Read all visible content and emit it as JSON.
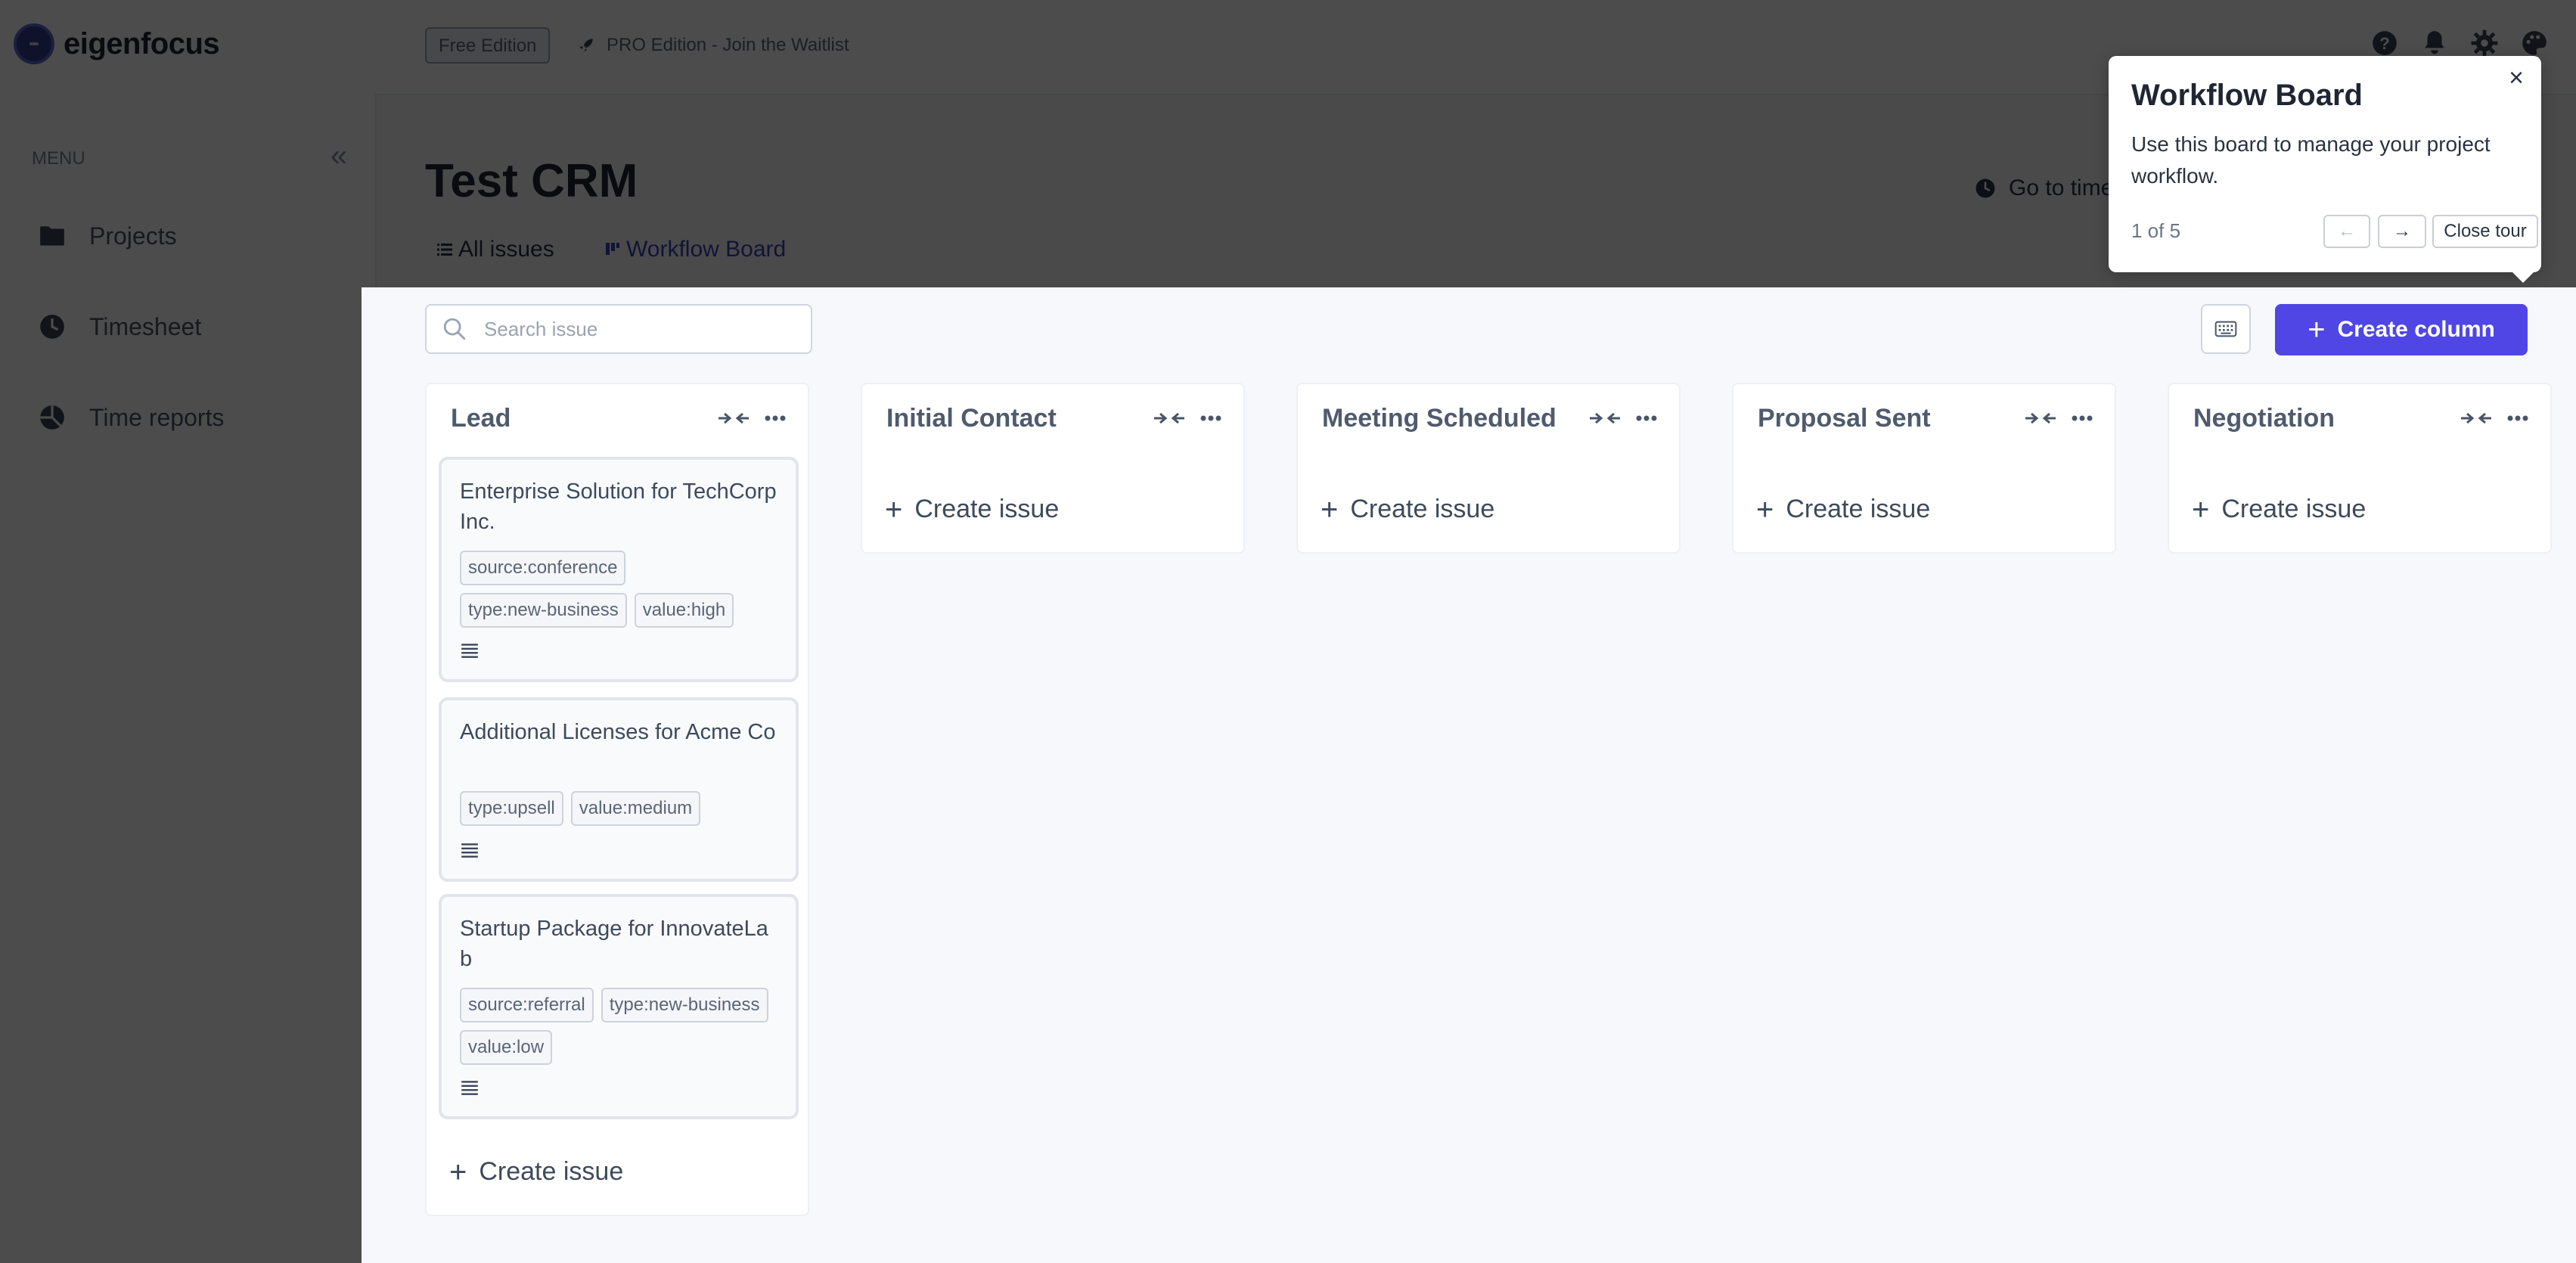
{
  "app": {
    "name": "eigenfocus"
  },
  "sidebar": {
    "menu_label": "MENU",
    "items": [
      {
        "label": "Projects",
        "icon": "folder-icon"
      },
      {
        "label": "Timesheet",
        "icon": "clock-icon"
      },
      {
        "label": "Time reports",
        "icon": "pie-chart-icon"
      }
    ]
  },
  "header": {
    "edition_badge": "Free Edition",
    "pro_link": "PRO Edition - Join the Waitlist",
    "icons": [
      "help-icon",
      "bell-icon",
      "gear-icon",
      "palette-icon"
    ]
  },
  "page": {
    "title": "Test CRM",
    "go_time_label": "Go to time",
    "tabs": [
      {
        "label": "All issues",
        "active": false
      },
      {
        "label": "Workflow Board",
        "active": true
      }
    ]
  },
  "board": {
    "search_placeholder": "Search issue",
    "create_column_label": "Create column",
    "create_issue_label": "Create issue",
    "columns": [
      {
        "title": "Lead",
        "cards": [
          {
            "title": "Enterprise Solution for TechCorp Inc.",
            "tags": [
              "source:conference",
              "type:new-business",
              "value:high"
            ]
          },
          {
            "title": "Additional Licenses for Acme Co",
            "tags": [
              "type:upsell",
              "value:medium"
            ]
          },
          {
            "title": "Startup Package for InnovateLab",
            "tags": [
              "source:referral",
              "type:new-business",
              "value:low"
            ]
          }
        ]
      },
      {
        "title": "Initial Contact",
        "cards": []
      },
      {
        "title": "Meeting Scheduled",
        "cards": []
      },
      {
        "title": "Proposal Sent",
        "cards": []
      },
      {
        "title": "Negotiation",
        "cards": []
      }
    ]
  },
  "tour": {
    "title": "Workflow Board",
    "description": "Use this board to manage your project workflow.",
    "progress": "1 of 5",
    "prev_label": "←",
    "next_label": "→",
    "close_label": "Close tour",
    "close_icon": "×"
  },
  "colors": {
    "accent": "#4f46e5",
    "overlay": "rgba(0,0,0,0.7)"
  }
}
